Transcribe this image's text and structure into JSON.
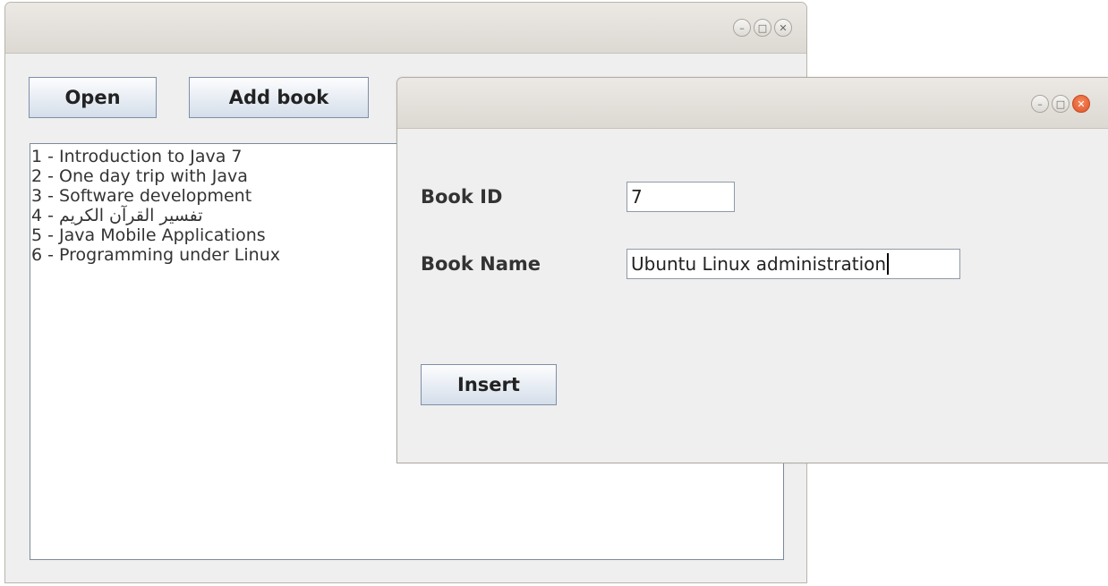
{
  "main_window": {
    "buttons": {
      "open_label": "Open",
      "add_book_label": "Add book"
    },
    "book_list": [
      {
        "prefix": "1 - ",
        "title": "Introduction to Java 7"
      },
      {
        "prefix": "2 - ",
        "title": "One day trip with Java"
      },
      {
        "prefix": "3 - ",
        "title": "Software development"
      },
      {
        "prefix": "4 - ",
        "title": "تفسير القرآن الكريم"
      },
      {
        "prefix": "5 - ",
        "title": "Java Mobile Applications"
      },
      {
        "prefix": "6 - ",
        "title": "Programming under Linux"
      }
    ]
  },
  "dialog": {
    "book_id_label": "Book ID",
    "book_id_value": "7",
    "book_name_label": "Book Name",
    "book_name_value": "Ubuntu Linux administration",
    "insert_label": "Insert"
  },
  "window_controls": {
    "minimize_icon": "minimize-icon",
    "maximize_icon": "maximize-icon",
    "close_icon": "close-icon",
    "close_active_color": "#e95c2f"
  }
}
